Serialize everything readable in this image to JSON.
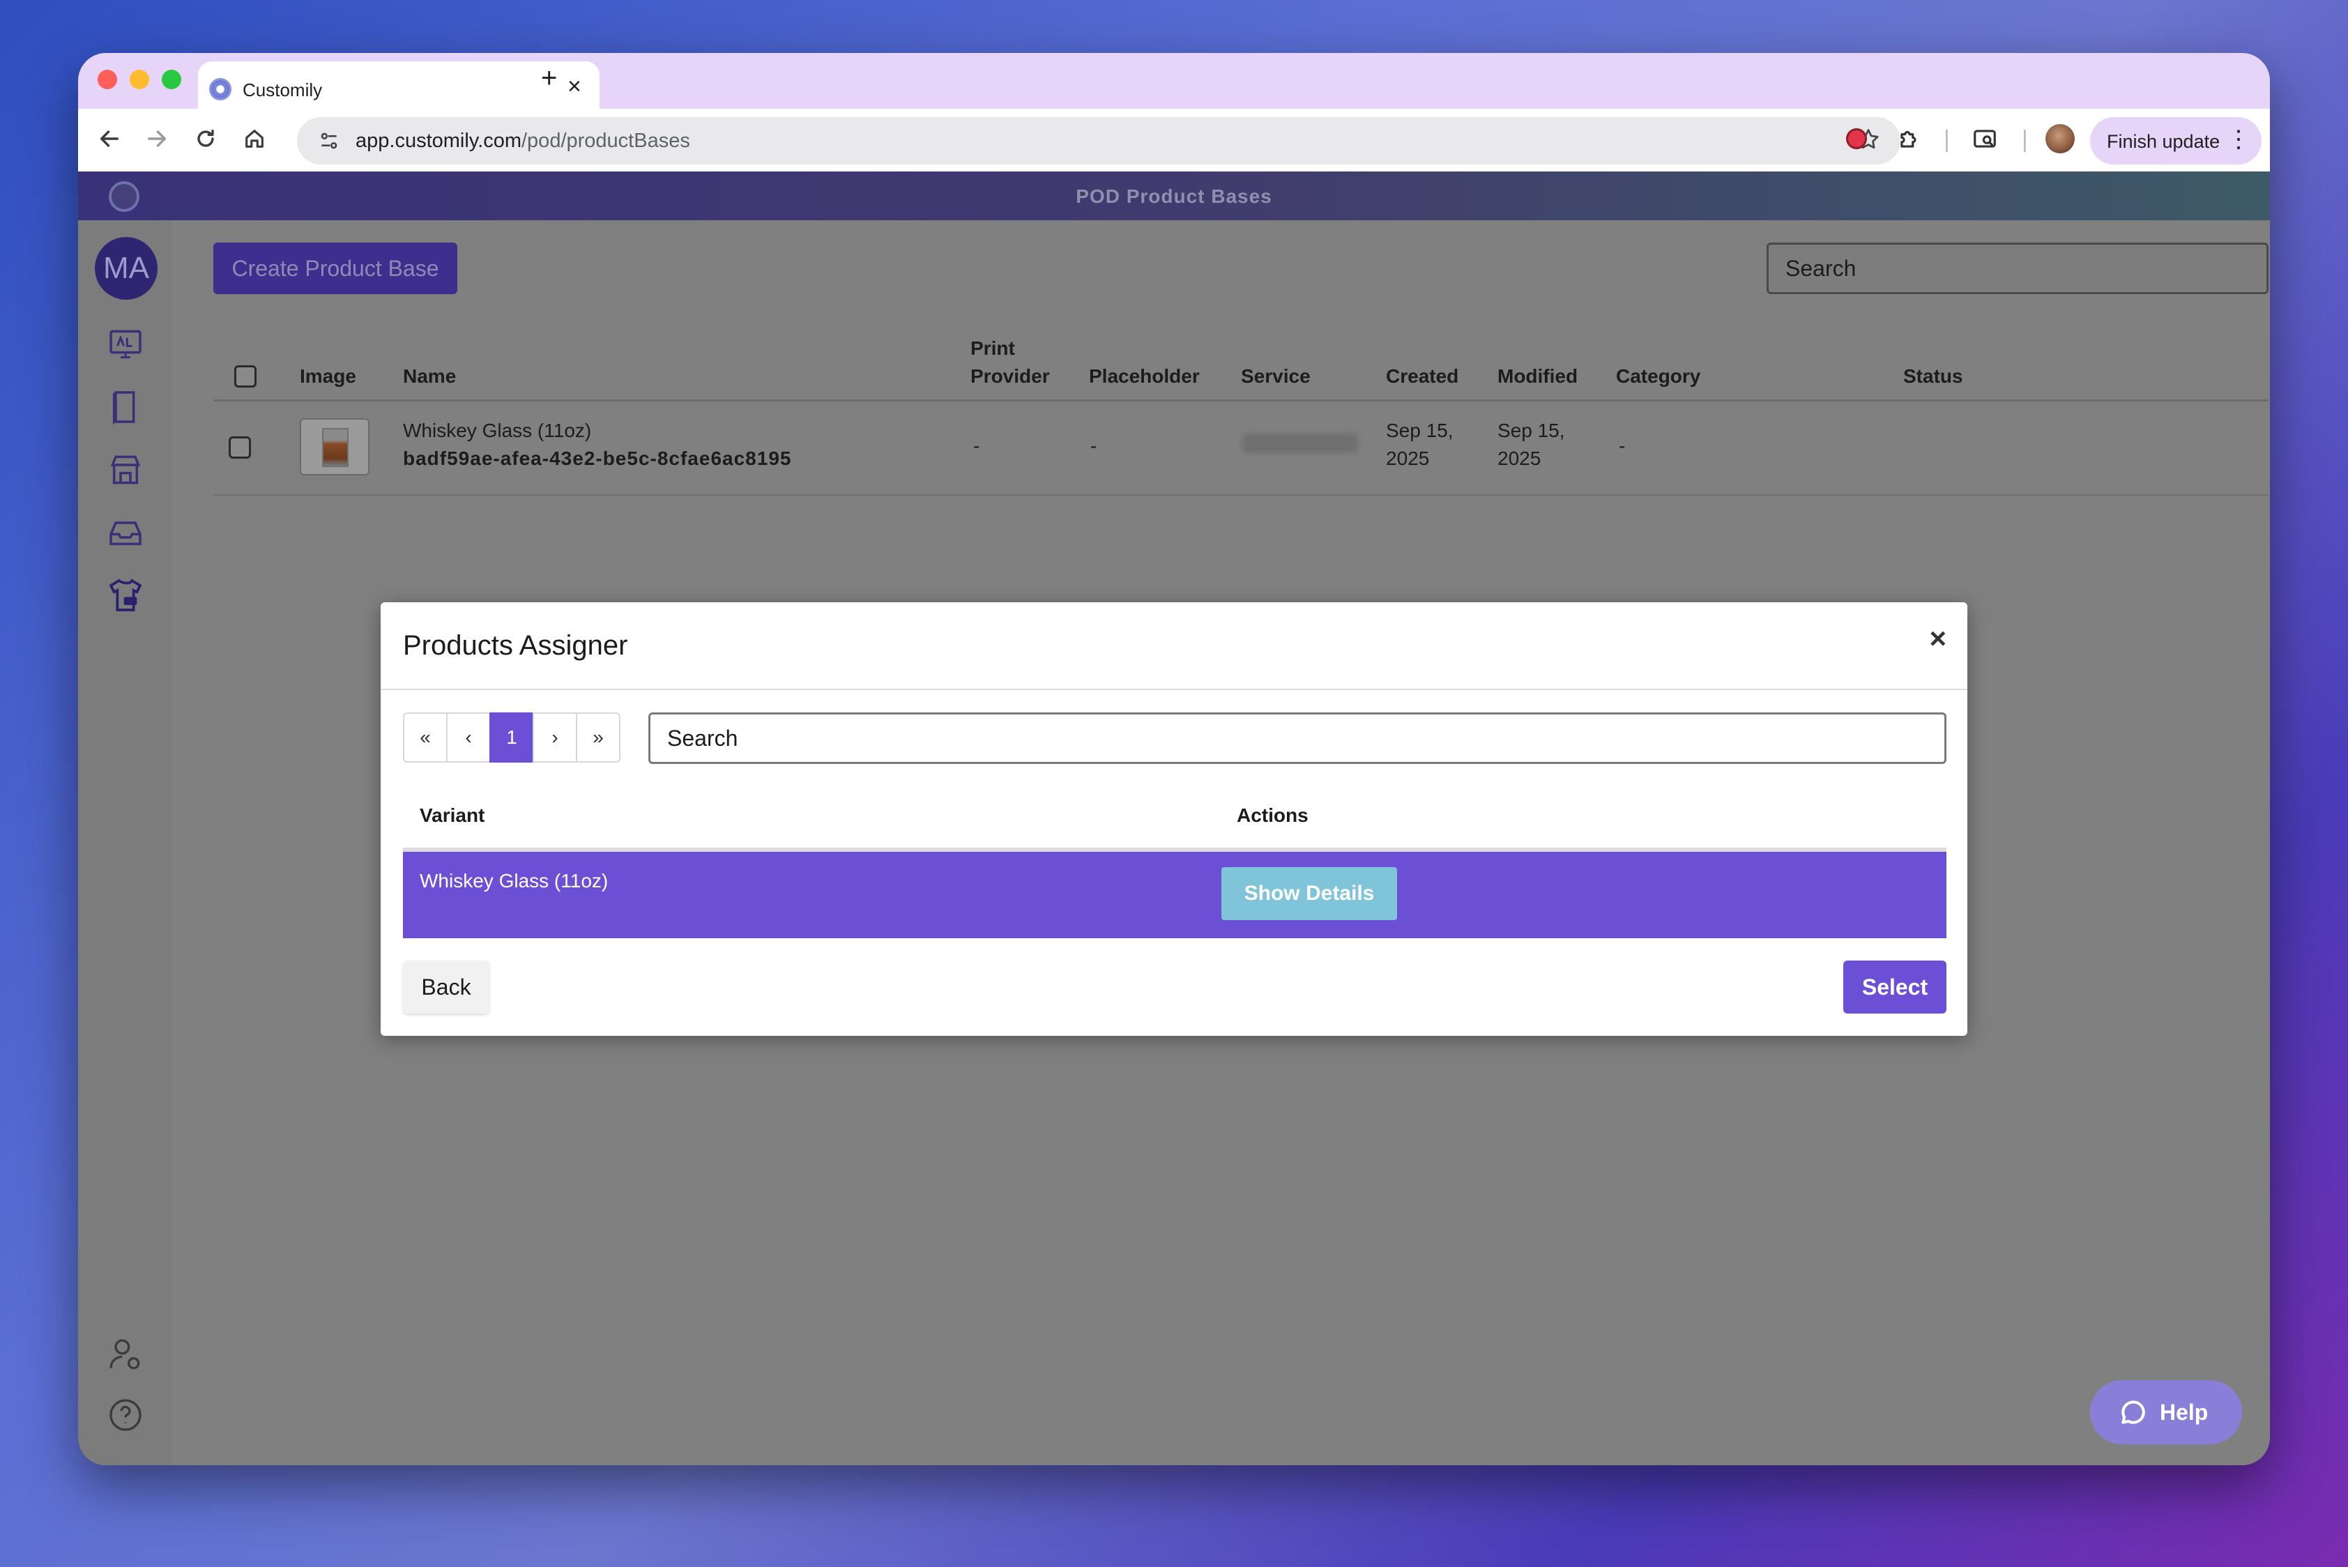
{
  "browser": {
    "tab_title": "Customily",
    "tab_close": "×",
    "new_tab": "+",
    "url_host": "app.customily.com",
    "url_path": "/pod/productBases",
    "finish_update": "Finish update",
    "menu_dots": "⋮"
  },
  "app": {
    "header_title": "POD Product Bases",
    "user_initials": "MA",
    "create_button": "Create Product Base",
    "search_placeholder": "Search",
    "sidebar_icons": [
      "designs-icon",
      "book-icon",
      "store-icon",
      "inbox-icon",
      "pod-shirt-icon",
      "user-settings-icon",
      "help-circle-icon",
      "logout-icon"
    ]
  },
  "table": {
    "headers": {
      "image": "Image",
      "name": "Name",
      "print_provider_line1": "Print",
      "print_provider_line2": "Provider",
      "placeholder": "Placeholder",
      "service": "Service",
      "created": "Created",
      "modified": "Modified",
      "category": "Category",
      "status": "Status"
    },
    "rows": [
      {
        "name": "Whiskey Glass (11oz)",
        "id": "badf59ae-afea-43e2-be5c-8cfae6ac8195",
        "print_provider": "-",
        "placeholder": "-",
        "created_line1": "Sep 15,",
        "created_line2": "2025",
        "modified_line1": "Sep 15,",
        "modified_line2": "2025",
        "category": "-"
      }
    ]
  },
  "modal": {
    "title": "Products Assigner",
    "close": "×",
    "pager": [
      "«",
      "‹",
      "1",
      "›",
      "»"
    ],
    "search_placeholder": "Search",
    "col_variant": "Variant",
    "col_actions": "Actions",
    "variant_name": "Whiskey Glass (11oz)",
    "show_details": "Show Details",
    "back": "Back",
    "select": "Select"
  },
  "help": {
    "label": "Help"
  },
  "colors": {
    "accent": "#6b4fd4",
    "details_button": "#7fc4d8",
    "tab_strip": "#e6d5f8"
  }
}
